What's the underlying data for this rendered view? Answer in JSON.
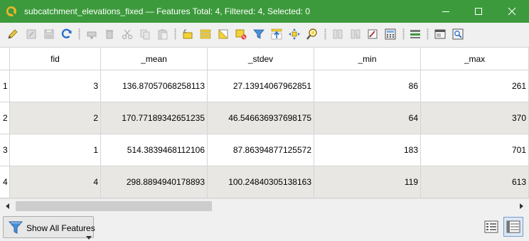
{
  "window": {
    "title": "subcatchment_elevations_fixed — Features Total: 4, Filtered: 4, Selected: 0",
    "accent": "#3c9a3c",
    "controls": [
      "minimize-icon",
      "maximize-icon",
      "close-icon"
    ]
  },
  "toolbar": {
    "buttons": [
      {
        "name": "toggle-editing-icon",
        "enabled": true
      },
      {
        "name": "multi-edit-icon",
        "enabled": false
      },
      {
        "name": "save-edits-icon",
        "enabled": false
      },
      {
        "name": "reload-icon",
        "enabled": true
      },
      {
        "name": "add-feature-icon",
        "enabled": false
      },
      {
        "name": "delete-feature-icon",
        "enabled": false
      },
      {
        "name": "cut-icon",
        "enabled": false
      },
      {
        "name": "copy-icon",
        "enabled": false
      },
      {
        "name": "paste-icon",
        "enabled": false
      },
      {
        "name": "select-by-expression-icon",
        "enabled": true
      },
      {
        "name": "select-all-icon",
        "enabled": true
      },
      {
        "name": "invert-selection-icon",
        "enabled": true
      },
      {
        "name": "deselect-all-icon",
        "enabled": true
      },
      {
        "name": "filter-select-icon",
        "enabled": true
      },
      {
        "name": "move-selection-top-icon",
        "enabled": true
      },
      {
        "name": "pan-to-selection-icon",
        "enabled": true
      },
      {
        "name": "zoom-to-selection-icon",
        "enabled": true
      },
      {
        "name": "new-field-icon",
        "enabled": false
      },
      {
        "name": "delete-field-icon",
        "enabled": false
      },
      {
        "name": "organize-columns-icon",
        "enabled": true
      },
      {
        "name": "field-calculator-icon",
        "enabled": true
      },
      {
        "name": "conditional-formatting-icon",
        "enabled": true
      },
      {
        "name": "actions-icon",
        "enabled": true
      },
      {
        "name": "dock-icon",
        "enabled": true
      }
    ]
  },
  "table": {
    "columns": [
      "fid",
      "_mean",
      "_stdev",
      "_min",
      "_max"
    ],
    "rows": [
      {
        "row_num": "1",
        "cells": [
          "3",
          "136.87057068258113",
          "27.13914067962851",
          "86",
          "261"
        ]
      },
      {
        "row_num": "2",
        "cells": [
          "2",
          "170.77189342651235",
          "46.546636937698175",
          "64",
          "370"
        ]
      },
      {
        "row_num": "3",
        "cells": [
          "1",
          "514.3839468112106",
          "87.86394877125572",
          "183",
          "701"
        ]
      },
      {
        "row_num": "4",
        "cells": [
          "4",
          "298.8894940178893",
          "100.24840305138163",
          "119",
          "613"
        ]
      }
    ],
    "alt_row_color": "#e9e7e3"
  },
  "bottom": {
    "filter_button_label": "Show All Features",
    "view_modes": [
      "form-view-icon",
      "table-view-icon"
    ],
    "active_view": "table-view-icon"
  }
}
